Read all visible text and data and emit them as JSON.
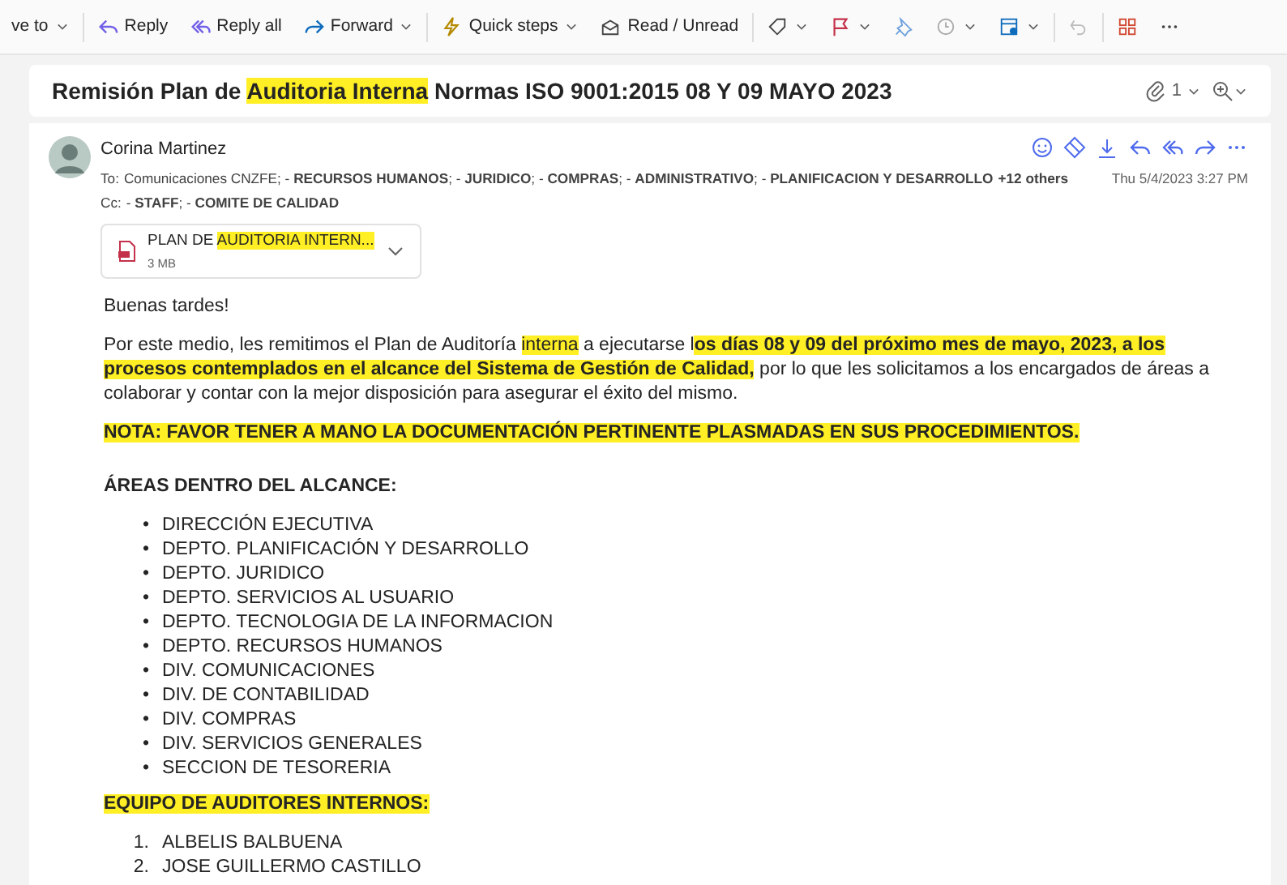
{
  "toolbar": [
    {
      "kind": "text",
      "label": "ve to",
      "dropdown": true
    },
    {
      "kind": "text",
      "label": "Reply",
      "dropdown": false
    },
    {
      "kind": "text",
      "label": "Reply all",
      "dropdown": false
    },
    {
      "kind": "text",
      "label": "Forward",
      "dropdown": true
    },
    {
      "kind": "text",
      "label": "Quick steps",
      "dropdown": true
    },
    {
      "kind": "text",
      "label": "Read / Unread",
      "dropdown": false
    },
    {
      "kind": "icon",
      "dropdown": true
    },
    {
      "kind": "icon",
      "dropdown": true
    },
    {
      "kind": "icon",
      "dropdown": false
    },
    {
      "kind": "icon",
      "dropdown": true
    },
    {
      "kind": "icon",
      "dropdown": true
    },
    {
      "kind": "icon",
      "dropdown": false
    },
    {
      "kind": "icon",
      "dropdown": false
    },
    {
      "kind": "icon",
      "dropdown": false
    }
  ],
  "subject": {
    "runs": [
      {
        "text": "Remisión Plan de ",
        "highlight": false
      },
      {
        "text": "Auditoria Interna",
        "highlight": true
      },
      {
        "text": " Normas ISO 9001:2015 08 Y 09 MAYO 2023",
        "highlight": false
      }
    ],
    "attachment_count": "1"
  },
  "message": {
    "sender": "Corina Martinez",
    "to_label": "To:",
    "to": "Comunicaciones CNZFE;  - **RECURSOS HUMANOS**;  - **JURIDICO**;  - **COMPRAS**;  - **ADMINISTRATIVO**;  - **PLANIFICACION Y DESARROLLO**",
    "others": "+12 others",
    "date": "Thu 5/4/2023 3:27 PM",
    "cc_label": "Cc:",
    "cc": "- **STAFF**;  - **COMITE DE CALIDAD**",
    "attachment": {
      "runs": [
        {
          "text": "PLAN DE ",
          "highlight": false
        },
        {
          "text": "AUDITORIA INTERN...",
          "highlight": true
        }
      ],
      "size": "3 MB"
    },
    "body": [
      {
        "kind": "paragraph",
        "runs": [
          {
            "text": "Buenas tardes!",
            "bold": false,
            "highlight": false
          }
        ]
      },
      {
        "kind": "paragraph",
        "runs": [
          {
            "text": "Por este medio, les remitimos el Plan de Auditoría ",
            "bold": false,
            "highlight": false
          },
          {
            "text": "interna",
            "bold": false,
            "highlight": true
          },
          {
            "text": " a ejecutarse l",
            "bold": false,
            "highlight": false
          },
          {
            "text": "os días 08 y 09 del próximo mes de mayo, 2023, a los procesos contemplados en el alcance del Sistema de Gestión de Calidad,",
            "bold": true,
            "highlight": true
          },
          {
            "text": " por lo que les solicitamos a los encargados de áreas a colaborar y contar con la mejor disposición para asegurar el éxito del mismo.",
            "bold": false,
            "highlight": false
          }
        ]
      },
      {
        "kind": "paragraph",
        "runs": [
          {
            "text": "NOTA: FAVOR TENER A MANO LA DOCUMENTACIÓN PERTINENTE PLASMADAS EN SUS PROCEDIMIENTOS.",
            "bold": true,
            "highlight": true
          }
        ]
      },
      {
        "kind": "heading",
        "runs": [
          {
            "text": "ÁREAS DENTRO DEL ALCANCE:",
            "bold": true,
            "highlight": false
          }
        ]
      },
      {
        "kind": "list",
        "items": [
          {
            "marker": "•",
            "text": "DIRECCIÓN EJECUTIVA"
          },
          {
            "marker": "•",
            "text": "DEPTO. PLANIFICACIÓN Y DESARROLLO"
          },
          {
            "marker": "•",
            "text": "DEPTO. JURIDICO"
          },
          {
            "marker": "•",
            "text": "DEPTO. SERVICIOS AL USUARIO"
          },
          {
            "marker": "•",
            "text": "DEPTO. TECNOLOGIA DE LA INFORMACION"
          },
          {
            "marker": "•",
            "text": "DEPTO. RECURSOS HUMANOS"
          },
          {
            "marker": "•",
            "text": "DIV. COMUNICACIONES"
          },
          {
            "marker": "•",
            "text": "DIV. DE CONTABILIDAD"
          },
          {
            "marker": "•",
            "text": "DIV. COMPRAS"
          },
          {
            "marker": "•",
            "text": "DIV. SERVICIOS GENERALES"
          },
          {
            "marker": "•",
            "text": "SECCION DE TESORERIA"
          }
        ]
      },
      {
        "kind": "paragraph",
        "runs": [
          {
            "text": "EQUIPO DE AUDITORES INTERNOS:",
            "bold": true,
            "highlight": true
          }
        ]
      },
      {
        "kind": "list",
        "items": [
          {
            "marker": "1.",
            "text": "ALBELIS BALBUENA"
          },
          {
            "marker": "2.",
            "text": "JOSE GUILLERMO CASTILLO"
          }
        ]
      }
    ]
  }
}
